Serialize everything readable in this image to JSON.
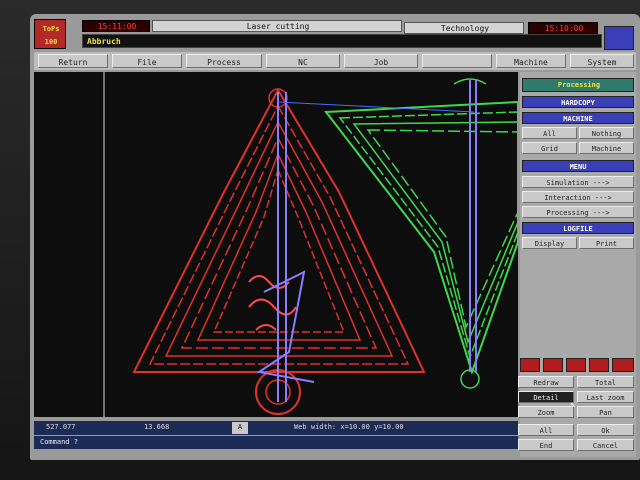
{
  "header": {
    "logo_top": "ToPs",
    "logo_bottom": "100",
    "time_left": "15:11:00",
    "title": "Laser cutting",
    "technology_label": "Technology",
    "time_right": "15:10:00",
    "status": "Abbruch"
  },
  "menu": [
    "Return",
    "File",
    "Process",
    "NC",
    "Job",
    "",
    "Machine",
    "System"
  ],
  "side": {
    "processing": "Processing",
    "hardcopy": "HARDCOPY",
    "machine_header": "MACHINE",
    "all": "All",
    "nothing": "Nothing",
    "grid": "Grid",
    "machine": "Machine",
    "menu_header": "MENU",
    "simulation": "Simulation --->",
    "interaction": "Interaction --->",
    "processing_item": "Processing --->",
    "logfile": "LOGFILE",
    "display": "Display",
    "print": "Print"
  },
  "bottom": {
    "redraw": "Redraw",
    "total": "Total",
    "detail": "Detail",
    "last_zoom": "Last zoom",
    "zoom": "Zoom",
    "pan": "Pan",
    "all": "All",
    "ok": "Ok",
    "end": "End",
    "cancel": "Cancel"
  },
  "status_bar": {
    "x": "527.077",
    "y": "13.668",
    "mode": "A",
    "web_width": "Web width: x=10.00 y=10.00"
  },
  "command": "Command ?",
  "colors": {
    "red_part": "#e0322a",
    "green_part": "#3ed94b",
    "path": "#8a7dff",
    "accent": "#3b3fb7"
  }
}
